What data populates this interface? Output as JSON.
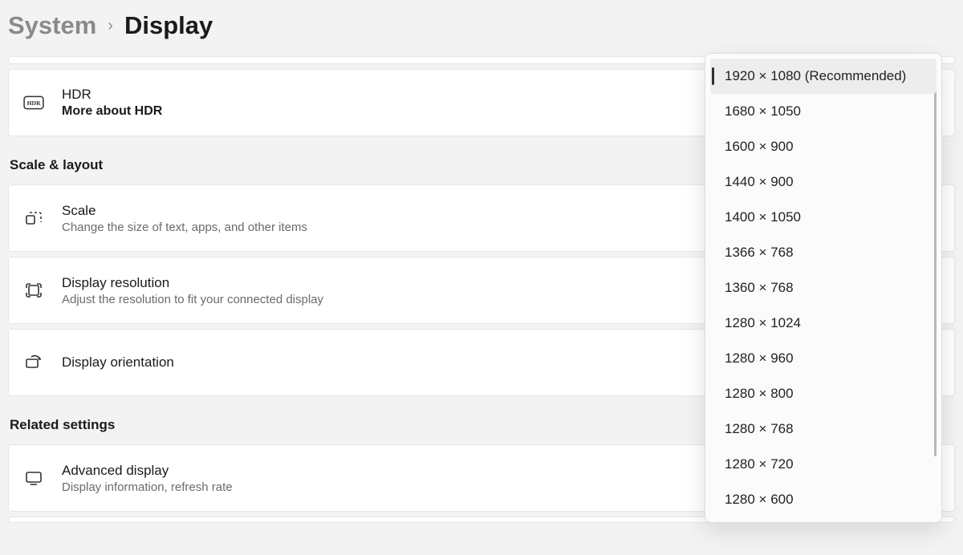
{
  "breadcrumb": {
    "parent": "System",
    "current": "Display"
  },
  "hdr": {
    "title": "HDR",
    "sub": "More about HDR"
  },
  "section_scale": "Scale & layout",
  "scale": {
    "title": "Scale",
    "sub": "Change the size of text, apps, and other items"
  },
  "resolution": {
    "title": "Display resolution",
    "sub": "Adjust the resolution to fit your connected display"
  },
  "orientation": {
    "title": "Display orientation"
  },
  "section_related": "Related settings",
  "advanced": {
    "title": "Advanced display",
    "sub": "Display information, refresh rate"
  },
  "resolutions": [
    "1920 × 1080 (Recommended)",
    "1680 × 1050",
    "1600 × 900",
    "1440 × 900",
    "1400 × 1050",
    "1366 × 768",
    "1360 × 768",
    "1280 × 1024",
    "1280 × 960",
    "1280 × 800",
    "1280 × 768",
    "1280 × 720",
    "1280 × 600"
  ],
  "selected_resolution_index": 0
}
